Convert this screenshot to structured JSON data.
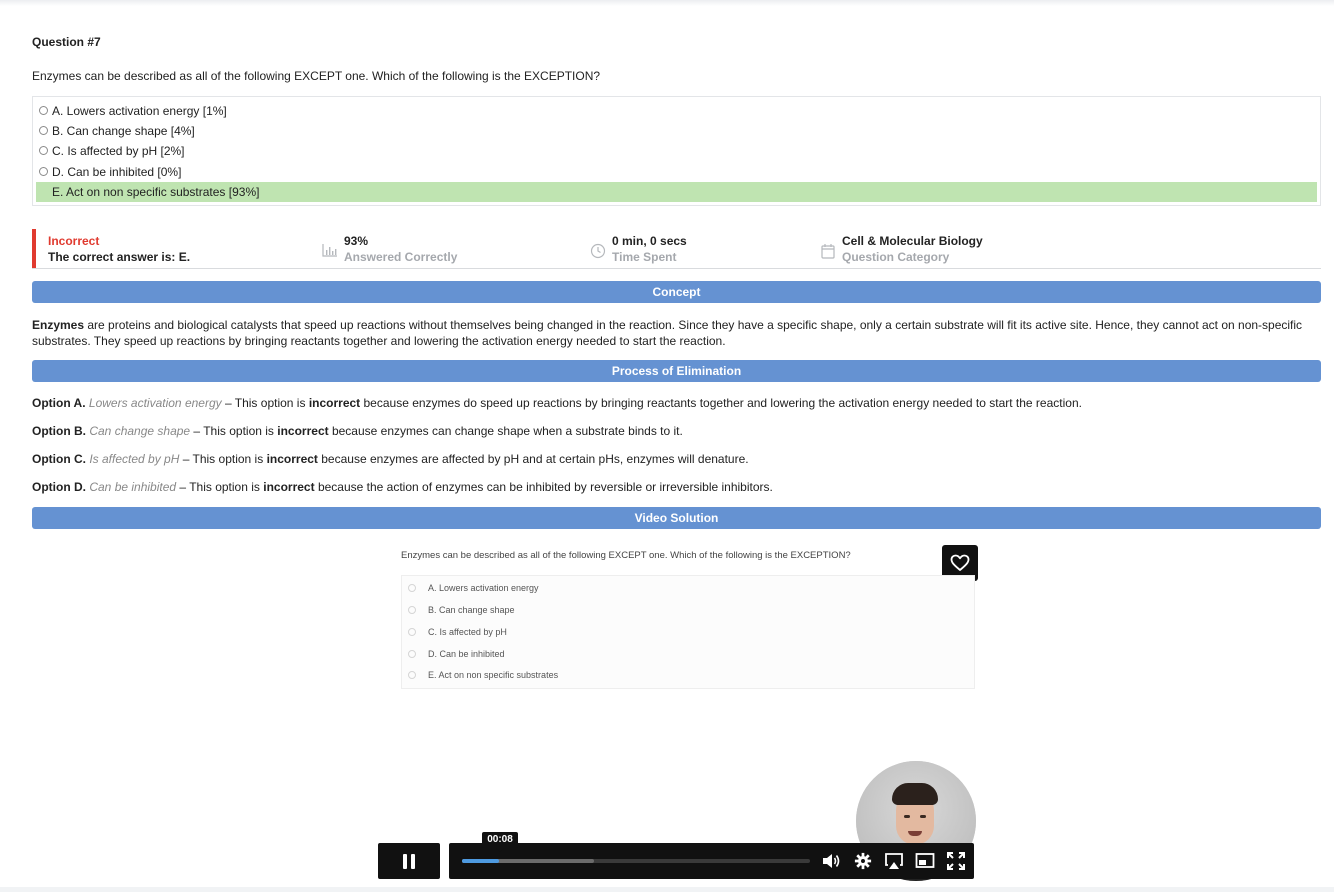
{
  "question": {
    "title": "Question #7",
    "text": "Enzymes can be described as all of the following EXCEPT one. Which of the following is the EXCEPTION?",
    "options": [
      {
        "label": "A. Lowers activation energy [1%]"
      },
      {
        "label": "B. Can change shape [4%]"
      },
      {
        "label": "C. Is affected by pH [2%]"
      },
      {
        "label": "D. Can be inhibited [0%]"
      },
      {
        "label": "E. Act on non specific substrates [93%]"
      }
    ]
  },
  "result": {
    "status": "Incorrect",
    "correct_answer": "The correct answer is: E.",
    "stats": [
      {
        "value": "93%",
        "label": "Answered Correctly",
        "icon": "bar-chart-icon"
      },
      {
        "value": "0 min, 0 secs",
        "label": "Time Spent",
        "icon": "clock-icon"
      },
      {
        "value": "Cell & Molecular Biology",
        "label": "Question Category",
        "icon": "calendar-icon"
      }
    ]
  },
  "sections": {
    "concept": "Concept",
    "elimination": "Process of Elimination",
    "video": "Video Solution"
  },
  "concept": {
    "term": "Enzymes",
    "text": " are proteins and biological catalysts that speed up reactions without themselves being changed in the reaction. Since they have a specific shape, only a certain substrate will fit its active site. Hence, they cannot act on non-specific substrates. They speed up reactions by bringing reactants together and lowering the activation energy needed to start the reaction."
  },
  "elimination": [
    {
      "option": "Option A.",
      "name": "Lowers activation energy",
      "dash": " – This option is ",
      "verdict": "incorrect",
      "reason": " because enzymes do speed up reactions by bringing reactants together and lowering the activation energy needed to start the reaction."
    },
    {
      "option": "Option B.",
      "name": "Can change shape",
      "dash": " – This option is ",
      "verdict": "incorrect",
      "reason": " because enzymes can change shape when a substrate binds to it."
    },
    {
      "option": "Option C.",
      "name": "Is affected by pH",
      "dash": " – This option is ",
      "verdict": "incorrect",
      "reason": " because enzymes are affected by pH and at certain pHs, enzymes will denature."
    },
    {
      "option": "Option D.",
      "name": "Can be inhibited",
      "dash": " – This option is ",
      "verdict": "incorrect",
      "reason": " because the action of enzymes can be inhibited by reversible or irreversible inhibitors."
    }
  ],
  "video": {
    "question": "Enzymes can be described as all of the following EXCEPT one. Which of the following is the EXCEPTION?",
    "options": [
      "A. Lowers activation energy",
      "B. Can change shape",
      "C. Is affected by pH",
      "D. Can be inhibited",
      "E. Act on non specific substrates"
    ],
    "time": "00:08",
    "progress_fraction": 0.105,
    "buffered_fraction": 0.38,
    "accent_color": "#4e9ae0"
  },
  "colors": {
    "section_bar": "#6592d2",
    "correct_highlight": "#bfe4b1",
    "incorrect_red": "#e03a2f"
  }
}
